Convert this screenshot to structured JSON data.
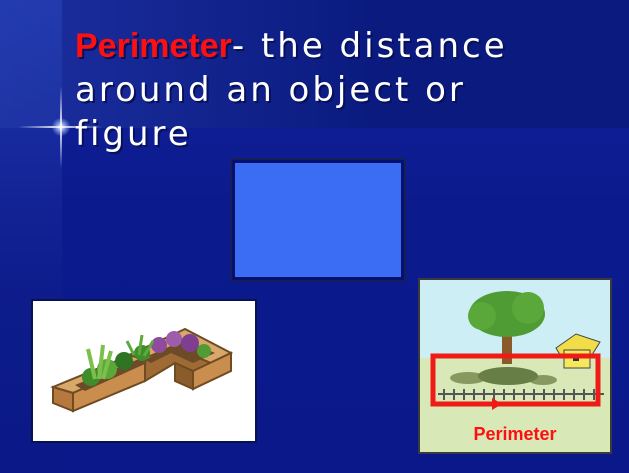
{
  "slide": {
    "title_term": "Perimeter",
    "title_rest": "- the distance around an object or figure"
  },
  "images": {
    "garden_caption": "Perimeter"
  },
  "colors": {
    "background": "#0b1a8c",
    "term": "#ff1010",
    "title_text": "#ffffff",
    "rectangle_fill": "#3a6cf4",
    "perimeter_border": "#ef1b17"
  },
  "icons": {
    "raised_bed": "raised-garden-bed-image",
    "yard": "yard-perimeter-image",
    "arrow": "arrow-right-icon"
  }
}
